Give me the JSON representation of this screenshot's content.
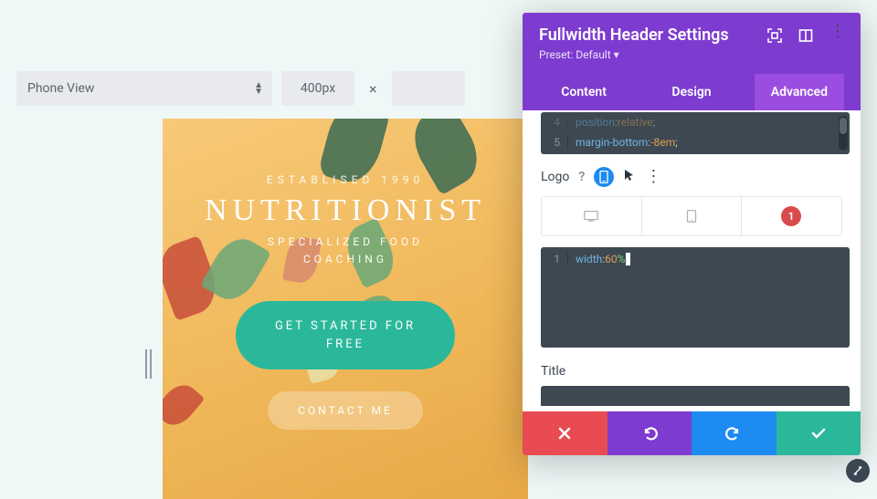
{
  "top": {
    "view_select": "Phone View",
    "width_value": "400px"
  },
  "preview": {
    "established": "ESTABLISED 1990",
    "brand": "NUTRITIONIST",
    "tagline1": "SPECIALIZED FOOD",
    "tagline2": "COACHING",
    "cta_primary": "GET STARTED FOR FREE",
    "cta_secondary": "CONTACT ME"
  },
  "panel": {
    "title": "Fullwidth Header Settings",
    "preset_label": "Preset: Default",
    "tabs": {
      "content": "Content",
      "design": "Design",
      "advanced": "Advanced"
    },
    "code_upper": {
      "line_no": "5",
      "prop": "margin-bottom",
      "val": "-8em"
    },
    "logo_label": "Logo",
    "badge_number": "1",
    "code_lower": {
      "line_no": "1",
      "prop": "width",
      "num": "60",
      "unit": "%"
    },
    "title_label": "Title"
  }
}
